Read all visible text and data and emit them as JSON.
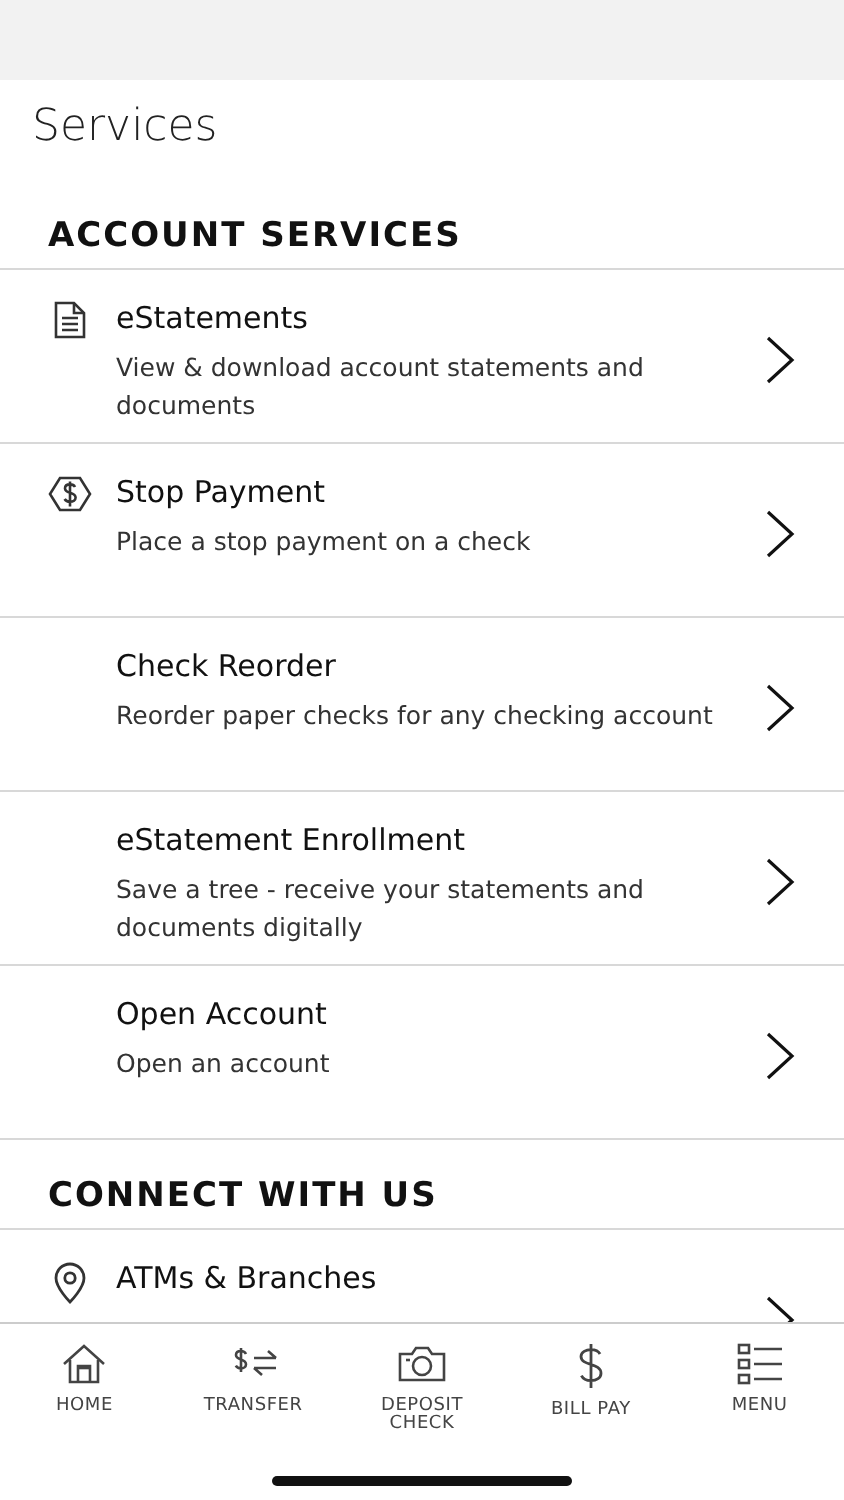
{
  "page_title": "Services",
  "sections": [
    {
      "heading": "ACCOUNT SERVICES",
      "items": [
        {
          "kind": "document",
          "title": "eStatements",
          "description": "View & download account statements and documents"
        },
        {
          "kind": "dollar",
          "title": "Stop Payment",
          "description": "Place a stop payment on a check"
        },
        {
          "kind": "plain",
          "title": "Check Reorder",
          "description": "Reorder paper checks for any checking account"
        },
        {
          "kind": "plain",
          "title": "eStatement Enrollment",
          "description": "Save a tree - receive your statements and documents digitally"
        },
        {
          "kind": "plain",
          "title": "Open Account",
          "description": "Open an account"
        }
      ]
    },
    {
      "heading": "CONNECT WITH US",
      "items": [
        {
          "kind": "location",
          "title": "ATMs & Branches"
        }
      ]
    }
  ],
  "tab_bar": [
    {
      "kind": "home",
      "label": "HOME"
    },
    {
      "kind": "transfer",
      "label": "TRANSFER"
    },
    {
      "kind": "camera",
      "label": "DEPOSIT CHECK"
    },
    {
      "kind": "dollar",
      "label": "BILL PAY"
    },
    {
      "kind": "menu",
      "label": "MENU"
    }
  ]
}
